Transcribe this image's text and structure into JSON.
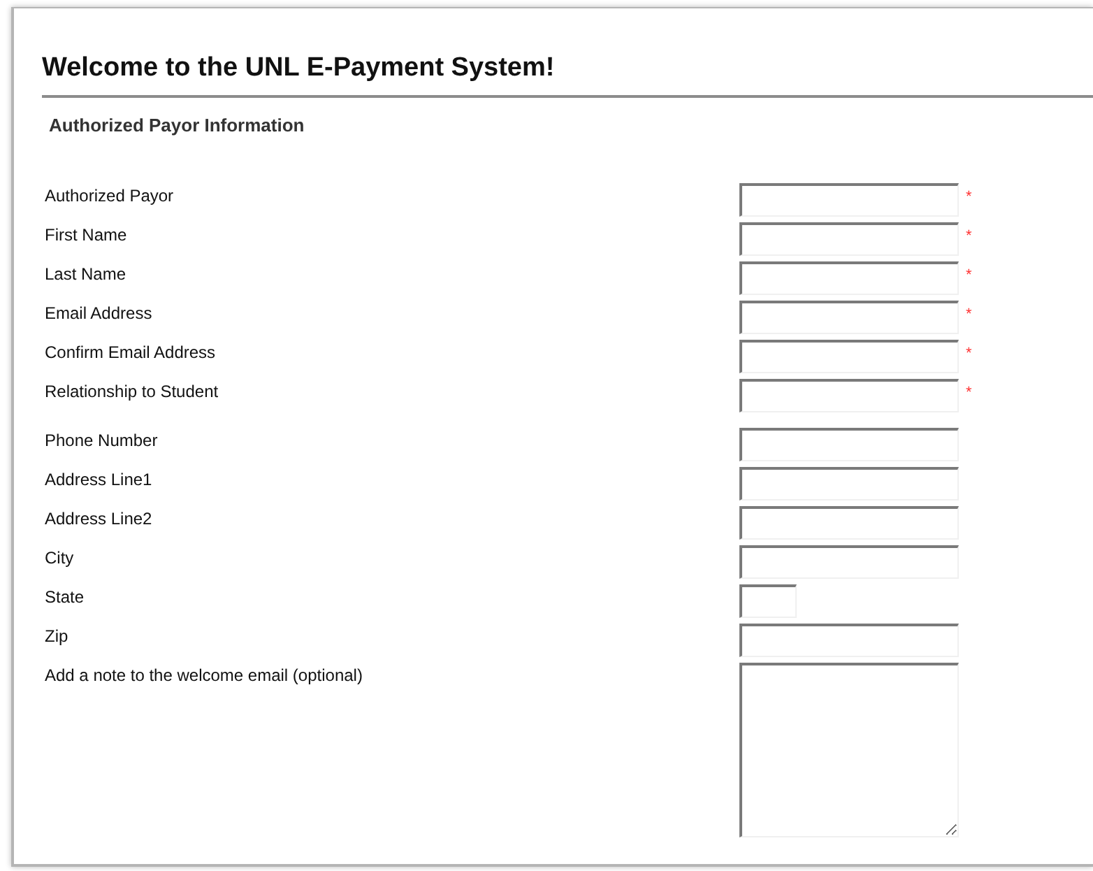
{
  "page": {
    "title": "Welcome to the UNL E-Payment System!"
  },
  "section": {
    "heading": "Authorized Payor Information"
  },
  "field_groups": [
    {
      "fields": [
        {
          "label": "Authorized Payor",
          "kind": "text",
          "required_mark": "*"
        },
        {
          "label": "First Name",
          "kind": "text",
          "required_mark": "*"
        },
        {
          "label": "Last Name",
          "kind": "text",
          "required_mark": "*"
        },
        {
          "label": "Email Address",
          "kind": "text",
          "required_mark": "*"
        },
        {
          "label": "Confirm Email Address",
          "kind": "text",
          "required_mark": "*"
        },
        {
          "label": "Relationship to Student",
          "kind": "text",
          "required_mark": "*"
        }
      ]
    },
    {
      "fields": [
        {
          "label": "Phone Number",
          "kind": "text"
        },
        {
          "label": "Address Line1",
          "kind": "text"
        },
        {
          "label": "Address Line2",
          "kind": "text"
        },
        {
          "label": "City",
          "kind": "text"
        },
        {
          "label": "State",
          "kind": "short"
        },
        {
          "label": "Zip",
          "kind": "text"
        },
        {
          "label": "Add a note to the welcome email (optional)",
          "kind": "textarea"
        }
      ]
    }
  ]
}
